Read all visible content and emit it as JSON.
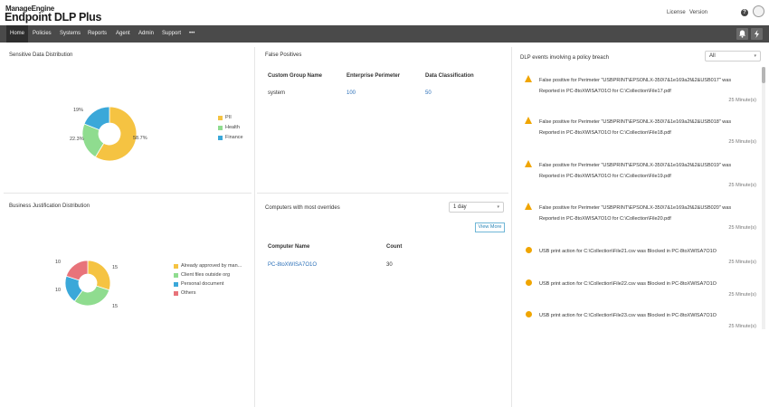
{
  "header": {
    "brand": "ManageEngine",
    "product": "Endpoint DLP Plus",
    "license_label": "License",
    "version_label": "Version",
    "help_glyph": "?"
  },
  "nav": {
    "items": [
      "Home",
      "Policies",
      "Systems",
      "Reports",
      "Agent",
      "Admin",
      "Support",
      "•••"
    ],
    "active": "Home",
    "icons": [
      "bell-icon",
      "lightning-icon"
    ]
  },
  "sensitive": {
    "title": "Sensitive Data Distribution",
    "legend": [
      "PII",
      "Health",
      "Finance"
    ]
  },
  "false_positives": {
    "title": "False Positives",
    "columns": [
      "Custom Group Name",
      "Enterprise Perimeter",
      "Data Classification"
    ],
    "rows": [
      [
        "system",
        "100",
        "50"
      ]
    ]
  },
  "business": {
    "title": "Business Justification Distribution",
    "legend": [
      "Already approved by man...",
      "Client files outside org",
      "Personal document",
      "Others"
    ]
  },
  "overrides": {
    "title": "Computers with most overrides",
    "period": "1 day",
    "view_more": "View More",
    "columns": [
      "Computer Name",
      "Count"
    ],
    "rows": [
      [
        "PC-8toXWISA7O1O",
        "30"
      ]
    ]
  },
  "events": {
    "title": "DLP events involving a policy breach",
    "filter": "All",
    "items": [
      {
        "text": "False positive for Perimeter \"USBPRINT\\EPSONLX-350\\7&1e169a2f&2&USB017\" was Reported in PC-8toXWISA7O1O for C:\\Collection\\File17.pdf",
        "time": "25 Minute(s)",
        "icon": "warning-icon"
      },
      {
        "text": "False positive for Perimeter \"USBPRINT\\EPSONLX-350\\7&1e169a2f&2&USB018\" was Reported in PC-8toXWISA7O1O for C:\\Collection\\File18.pdf",
        "time": "25 Minute(s)",
        "icon": "warning-icon"
      },
      {
        "text": "False positive for Perimeter \"USBPRINT\\EPSONLX-350\\7&1e169a2f&2&USB019\" was Reported in PC-8toXWISA7O1O for C:\\Collection\\File19.pdf",
        "time": "25 Minute(s)",
        "icon": "warning-icon"
      },
      {
        "text": "False positive for Perimeter \"USBPRINT\\EPSONLX-350\\7&1e169a2f&2&USB020\" was Reported in PC-8toXWISA7O1O for C:\\Collection\\File20.pdf",
        "time": "25 Minute(s)",
        "icon": "warning-icon"
      },
      {
        "text": "USB print action for C:\\Collection\\File21.csv was Blocked in PC-8toXWISA7O1O",
        "time": "25 Minute(s)",
        "icon": "alert-circle-icon"
      },
      {
        "text": "USB print action for C:\\Collection\\File22.csv was Blocked in PC-8toXWISA7O1O",
        "time": "25 Minute(s)",
        "icon": "alert-circle-icon"
      },
      {
        "text": "USB print action for C:\\Collection\\File23.csv was Blocked in PC-8toXWISA7O1O",
        "time": "25 Minute(s)",
        "icon": "alert-circle-icon"
      }
    ]
  },
  "colors": {
    "yellow": "#f5c342",
    "green": "#8fdc8f",
    "blue": "#3ba8d9",
    "red": "#e8737a",
    "nav_bg": "#4a4a4a",
    "link": "#2a6fb8",
    "warning": "#f0a500"
  },
  "chart_data": [
    {
      "type": "pie",
      "title": "Sensitive Data Distribution",
      "categories": [
        "PII",
        "Health",
        "Finance"
      ],
      "values": [
        58.7,
        22.3,
        19
      ],
      "labels": [
        "58.7%",
        "22.3%",
        "19%"
      ],
      "colors": [
        "#f5c342",
        "#8fdc8f",
        "#3ba8d9"
      ],
      "legend": "right"
    },
    {
      "type": "pie",
      "title": "Business Justification Distribution",
      "categories": [
        "Already approved by man...",
        "Client files outside org",
        "Personal document",
        "Others"
      ],
      "values": [
        15,
        15,
        10,
        10
      ],
      "labels": [
        "15",
        "15",
        "10",
        "10"
      ],
      "colors": [
        "#f5c342",
        "#8fdc8f",
        "#3ba8d9",
        "#e8737a"
      ],
      "legend": "right"
    }
  ]
}
